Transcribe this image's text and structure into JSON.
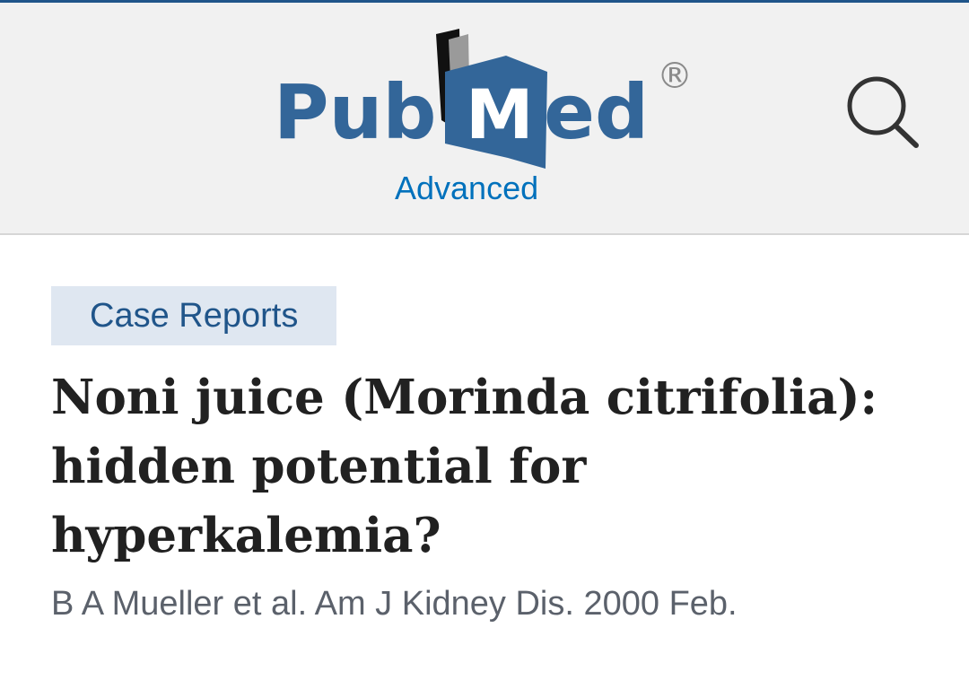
{
  "header": {
    "logo": {
      "word_left": "Pub",
      "word_right": "ed",
      "book_letter": "M",
      "registered_mark": "®",
      "subtitle": "Advanced",
      "brand_color": "#336699",
      "subtitle_color": "#0071bc"
    },
    "search_icon": "search-icon"
  },
  "article": {
    "publication_type": "Case Reports",
    "title": "Noni juice (Morinda citrifolia): hidden potential for hyperkalemia?",
    "citation": "B A Mueller et al. Am J Kidney Dis. 2000 Feb."
  },
  "colors": {
    "top_rule": "#20558a",
    "header_bg": "#f1f1f1",
    "badge_bg": "#dfe7f1",
    "badge_text": "#20558a",
    "title_text": "#212121",
    "citation_text": "#5b616b"
  }
}
